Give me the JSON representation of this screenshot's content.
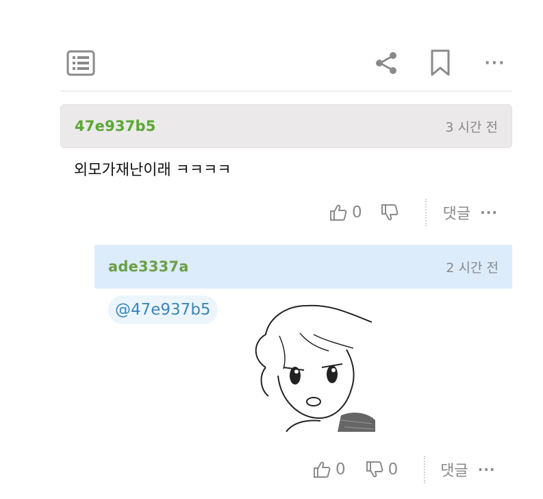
{
  "toolbar": {
    "list_icon": "list-icon",
    "share_icon": "share-icon",
    "bookmark_icon": "bookmark-icon",
    "more_icon": "more-icon",
    "more_label": "···"
  },
  "comments": [
    {
      "author": "47e937b5",
      "time": "3 시간 전",
      "text": "외모가재난이래 ㅋㅋㅋㅋ",
      "likes": "0",
      "reply_label": "댓글",
      "more_label": "···"
    }
  ],
  "reply": {
    "author": "ade3337a",
    "time": "2 시간 전",
    "mention": "@47e937b5",
    "sticker": "sticker-image",
    "likes": "0",
    "dislikes": "0",
    "reply_label": "댓글",
    "more_label": "···"
  },
  "colors": {
    "author": "#5aa833",
    "mention": "#3a86b8",
    "reply_header_bg": "#dcecfb",
    "comment_header_bg": "#ebe9ea"
  }
}
